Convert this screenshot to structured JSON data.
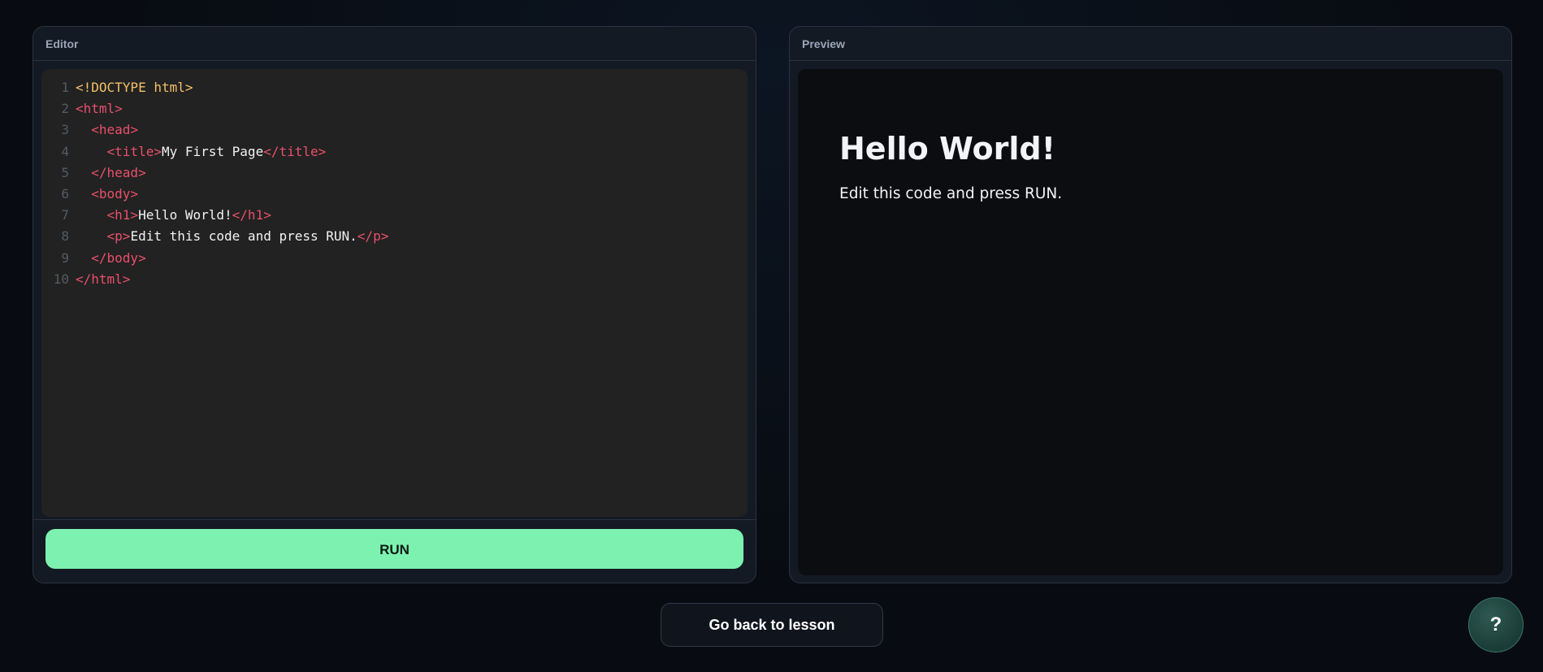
{
  "editor": {
    "title": "Editor",
    "lines": [
      {
        "num": "1",
        "tokens": [
          {
            "t": "doctype",
            "v": "<!DOCTYPE html>"
          }
        ]
      },
      {
        "num": "2",
        "tokens": [
          {
            "t": "tag",
            "v": "<html>"
          }
        ]
      },
      {
        "num": "3",
        "tokens": [
          {
            "t": "text",
            "v": "  "
          },
          {
            "t": "tag",
            "v": "<head>"
          }
        ]
      },
      {
        "num": "4",
        "tokens": [
          {
            "t": "text",
            "v": "    "
          },
          {
            "t": "tag",
            "v": "<title>"
          },
          {
            "t": "text",
            "v": "My First Page"
          },
          {
            "t": "tag",
            "v": "</title>"
          }
        ]
      },
      {
        "num": "5",
        "tokens": [
          {
            "t": "text",
            "v": "  "
          },
          {
            "t": "tag",
            "v": "</head>"
          }
        ]
      },
      {
        "num": "6",
        "tokens": [
          {
            "t": "text",
            "v": "  "
          },
          {
            "t": "tag",
            "v": "<body>"
          }
        ]
      },
      {
        "num": "7",
        "tokens": [
          {
            "t": "text",
            "v": "    "
          },
          {
            "t": "tag",
            "v": "<h1>"
          },
          {
            "t": "text",
            "v": "Hello World!"
          },
          {
            "t": "tag",
            "v": "</h1>"
          }
        ]
      },
      {
        "num": "8",
        "tokens": [
          {
            "t": "text",
            "v": "    "
          },
          {
            "t": "tag",
            "v": "<p>"
          },
          {
            "t": "text",
            "v": "Edit this code and press RUN."
          },
          {
            "t": "tag",
            "v": "</p>"
          }
        ]
      },
      {
        "num": "9",
        "tokens": [
          {
            "t": "text",
            "v": "  "
          },
          {
            "t": "tag",
            "v": "</body>"
          }
        ]
      },
      {
        "num": "10",
        "tokens": [
          {
            "t": "tag",
            "v": "</html>"
          }
        ]
      }
    ],
    "run_label": "RUN"
  },
  "preview": {
    "title": "Preview",
    "heading": "Hello World!",
    "paragraph": "Edit this code and press RUN."
  },
  "footer": {
    "back_label": "Go back to lesson",
    "help_label": "?"
  },
  "colors": {
    "run_button": "#7df2b0",
    "tag": "#e8506a",
    "doctype": "#f4c06a",
    "code_bg": "#222222",
    "preview_bg": "#0b0d11"
  },
  "icons": {
    "help": "question-mark-icon"
  }
}
